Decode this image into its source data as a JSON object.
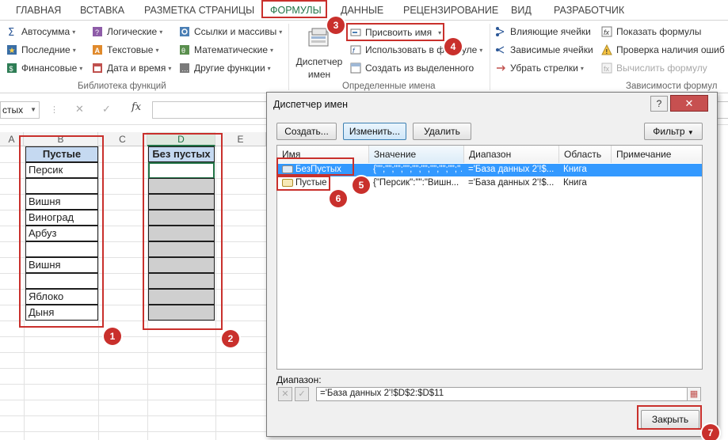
{
  "ribbon": {
    "tabs": [
      "ГЛАВНАЯ",
      "ВСТАВКА",
      "РАЗМЕТКА СТРАНИЦЫ",
      "ФОРМУЛЫ",
      "ДАННЫЕ",
      "РЕЦЕНЗИРОВАНИЕ",
      "ВИД",
      "РАЗРАБОТЧИК"
    ],
    "active_tab": "ФОРМУЛЫ",
    "function_library": {
      "items": [
        "Автосумма",
        "Логические",
        "Ссылки и массивы",
        "Последние",
        "Текстовые",
        "Математические",
        "Финансовые",
        "Дата и время",
        "Другие функции"
      ],
      "label": "Библиотека функций"
    },
    "defined_names": {
      "name_manager": "Диспетчер",
      "name_manager_2": "имен",
      "assign_name": "Присвоить имя",
      "use_in_formula": "Использовать в формуле",
      "create_from_selection": "Создать из выделенного",
      "label": "Определенные имена"
    },
    "formula_auditing": {
      "trace_precedents": "Влияющие ячейки",
      "trace_dependents": "Зависимые ячейки",
      "remove_arrows": "Убрать стрелки",
      "show_formulas": "Показать формулы",
      "error_checking": "Проверка наличия ошиб",
      "evaluate_formula": "Вычислить формулу",
      "label": "Зависимости формул"
    }
  },
  "formula_bar": {
    "name_box": "стых",
    "cancel_icon": "✕",
    "enter_icon": "✓",
    "fx": "fx"
  },
  "grid": {
    "columns": [
      "A",
      "B",
      "C",
      "D",
      "E"
    ],
    "column_b_header": "Пустые",
    "column_b_values": [
      "Персик",
      "",
      "Вишня",
      "Виноград",
      "Арбуз",
      "",
      "Вишня",
      "",
      "Яблоко",
      "Дыня"
    ],
    "column_d_header": "Без пустых"
  },
  "annotations": [
    "1",
    "2",
    "3",
    "4",
    "5",
    "6",
    "7"
  ],
  "dialog": {
    "title": "Диспетчер имен",
    "help": "?",
    "close_x": "✕",
    "buttons": {
      "create": "Создать...",
      "edit": "Изменить...",
      "delete": "Удалить",
      "filter": "Фильтр"
    },
    "columns": [
      "Имя",
      "Значение",
      "Диапазон",
      "Область",
      "Примечание"
    ],
    "rows": [
      {
        "name": "БезПустых",
        "value": "{\"\";\"\";\"\";\"\";\"\";\"\";\"\";\"\";\"\";\"...",
        "range": "='База данных 2'!$...",
        "scope": "Книга",
        "note": ""
      },
      {
        "name": "Пустые",
        "value": "{\"Персик\":\"\":\"Вишн...",
        "range": "='База данных 2'!$...",
        "scope": "Книга",
        "note": ""
      }
    ],
    "range_label": "Диапазон:",
    "range_value": "='База данных 2'!$D$2:$D$11",
    "close_button": "Закрыть"
  },
  "colors": {
    "accent_green": "#217346",
    "annotation_red": "#c9302c",
    "header_blue": "#c5d9f1",
    "selected_row": "#3399ff"
  }
}
